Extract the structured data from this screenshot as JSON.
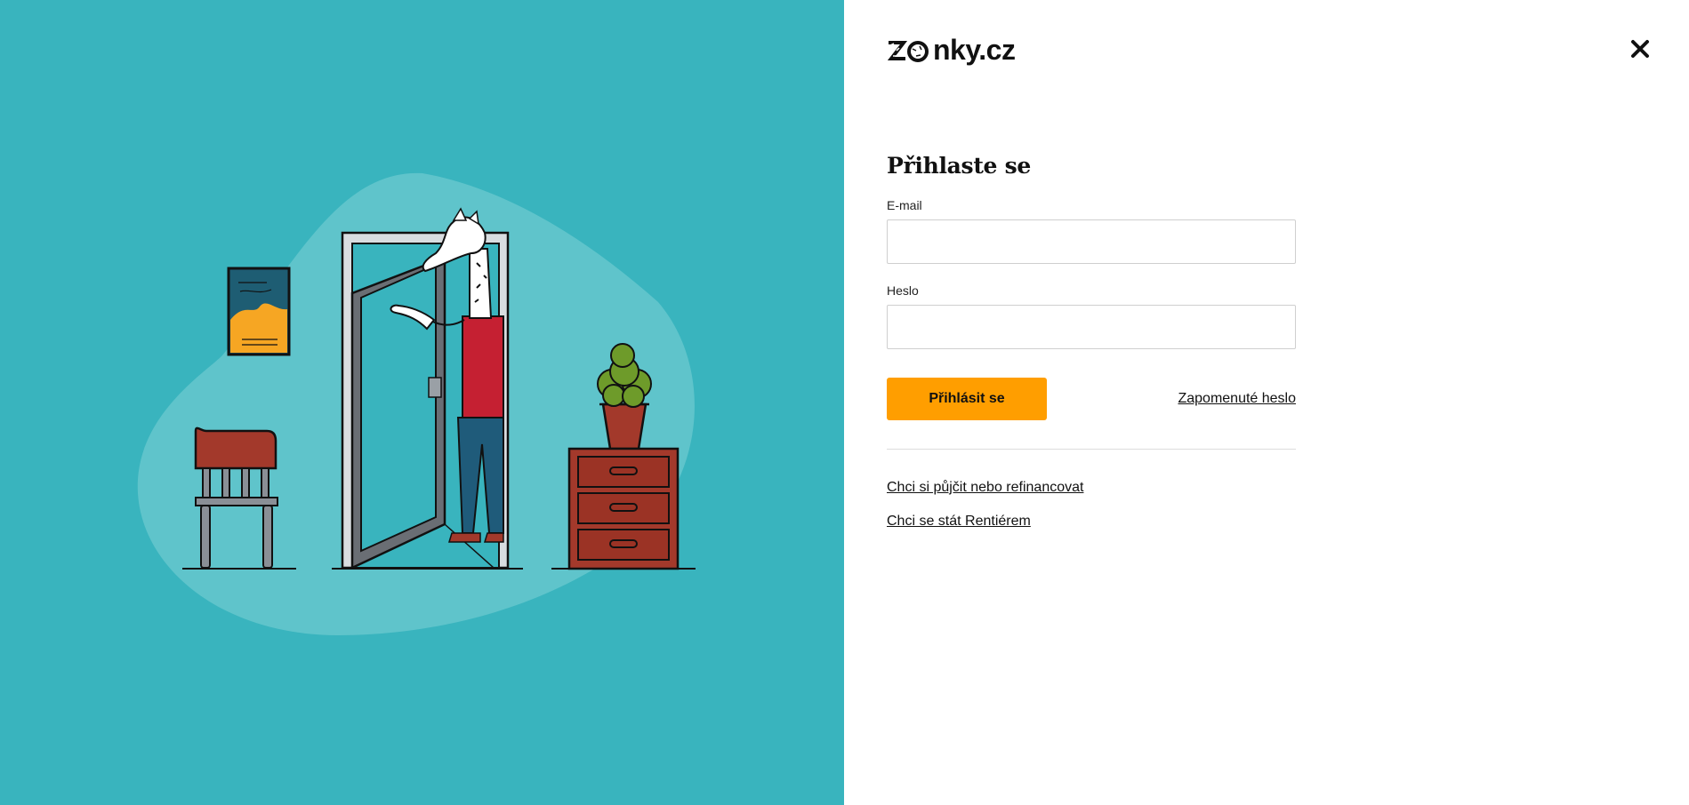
{
  "brand": {
    "logo_text": "nky.cz",
    "logo_prefix_icon": "zebra-pattern-zo-icon"
  },
  "header": {
    "close_icon": "close-icon"
  },
  "login": {
    "title": "Přihlaste se",
    "email_label": "E-mail",
    "email_value": "",
    "email_placeholder": "",
    "password_label": "Heslo",
    "password_value": "",
    "password_placeholder": "",
    "submit_label": "Přihlásit se",
    "forgot_password": "Zapomenuté heslo"
  },
  "links": {
    "borrow": "Chci si půjčit nebo refinancovat",
    "rentier": "Chci se stát Rentiérem"
  },
  "colors": {
    "left_background": "#39b4be",
    "blob": "#5fc4cb",
    "accent": "#ff9e00",
    "text": "#111111"
  },
  "illustration": {
    "description_icons": [
      "picture-frame-icon",
      "chair-icon",
      "door-icon",
      "zebra-character-icon",
      "plant-pot-icon",
      "drawer-cabinet-icon"
    ]
  }
}
